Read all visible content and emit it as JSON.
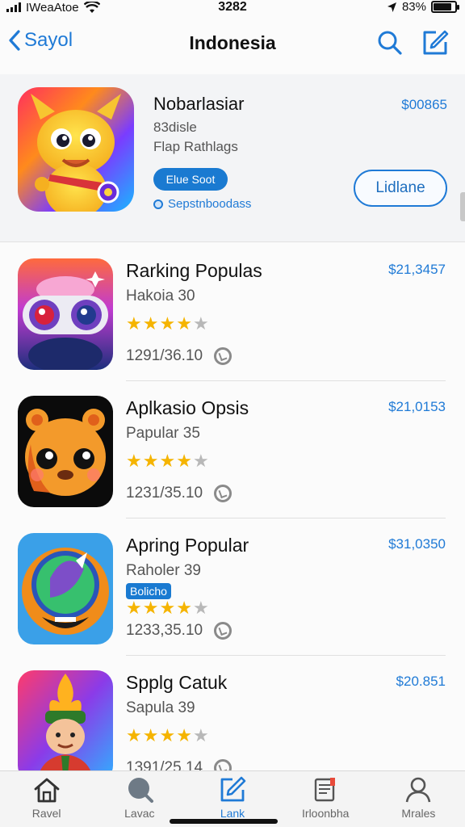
{
  "status_bar": {
    "carrier": "IWeaAtoe",
    "time": "3282",
    "battery": "83%",
    "battery_level": 0.83
  },
  "nav": {
    "back_label": "Sayol",
    "title": "Indonesia",
    "icons": [
      "search-icon",
      "compose-icon"
    ]
  },
  "featured": {
    "name": "Nobarlasiar",
    "sub1": "83disle",
    "sub2": "Flap Rathlags",
    "badge": "Elue Soot",
    "link": "Sepstnboodass",
    "price": "$00865",
    "button": "Lidlane"
  },
  "apps": [
    {
      "title": "Rarking Populas",
      "subtitle": "Hakoia 30",
      "tag": "",
      "rating": 4,
      "meta": "1291/36.10",
      "price": "$21,3457"
    },
    {
      "title": "Aplkasio Opsis",
      "subtitle": "Papular 35",
      "tag": "",
      "rating": 4,
      "meta": "1231/35.10",
      "price": "$21,0153"
    },
    {
      "title": "Apring Popular",
      "subtitle": "Raholer 39",
      "tag": "Bolicho",
      "rating": 4,
      "meta": "1233,35.10",
      "price": "$31,0350"
    },
    {
      "title": "Spplg Catuk",
      "subtitle": "Sapula 39",
      "tag": "",
      "rating": 4,
      "meta": "1391/25.14",
      "price": "$20.851"
    }
  ],
  "tabs": [
    {
      "label": "Ravel",
      "icon": "home-icon"
    },
    {
      "label": "Lavac",
      "icon": "search-bubble-icon"
    },
    {
      "label": "Lank",
      "icon": "edit-icon"
    },
    {
      "label": "Irloonbha",
      "icon": "document-icon"
    },
    {
      "label": "Mrales",
      "icon": "person-icon"
    }
  ],
  "colors": {
    "accent": "#1f7ad6",
    "star": "#f5b400",
    "star_empty": "#b8b8b8"
  }
}
